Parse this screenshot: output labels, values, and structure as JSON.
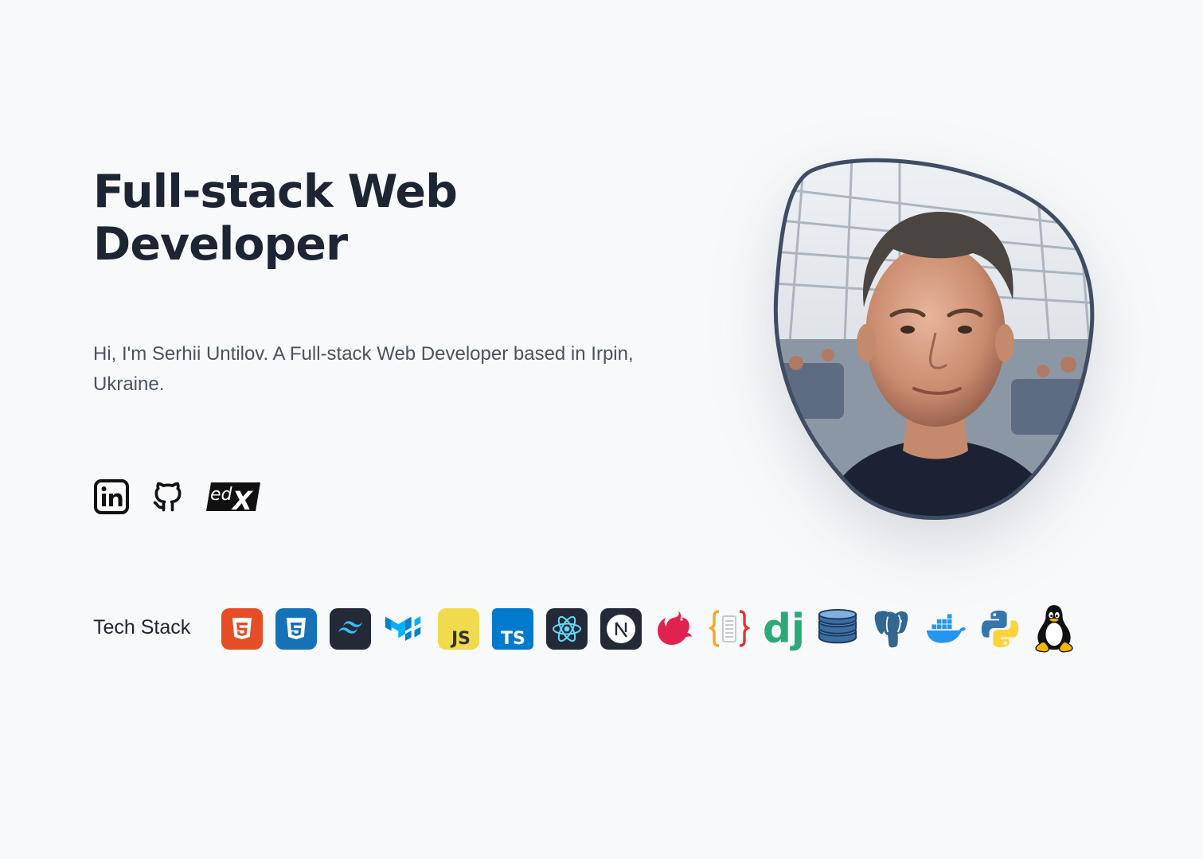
{
  "hero": {
    "title": "Full-stack Web Developer",
    "intro": "Hi, I'm Serhii Untilov. A Full-stack Web Developer based in Irpin, Ukraine."
  },
  "socials": [
    {
      "name": "LinkedIn",
      "icon": "linkedin-icon"
    },
    {
      "name": "GitHub",
      "icon": "github-icon"
    },
    {
      "name": "edX",
      "icon": "edx-icon"
    }
  ],
  "tech_stack": {
    "label": "Tech Stack",
    "items": [
      {
        "name": "HTML5",
        "icon": "html5-icon",
        "color": "#e44d26"
      },
      {
        "name": "CSS3",
        "icon": "css3-icon",
        "color": "#1572b6"
      },
      {
        "name": "Tailwind CSS",
        "icon": "tailwind-icon",
        "color": "#38bdf8"
      },
      {
        "name": "Material UI",
        "icon": "mui-icon",
        "color": "#0081cb"
      },
      {
        "name": "JavaScript",
        "icon": "javascript-icon",
        "color": "#f0db4f"
      },
      {
        "name": "TypeScript",
        "icon": "typescript-icon",
        "color": "#007acc"
      },
      {
        "name": "React",
        "icon": "react-icon",
        "color": "#61dafb"
      },
      {
        "name": "Next.js",
        "icon": "nextjs-icon",
        "color": "#1f2430"
      },
      {
        "name": "NestJS",
        "icon": "nestjs-icon",
        "color": "#e0234e"
      },
      {
        "name": "JSON",
        "icon": "json-icon",
        "color": "#f5a623"
      },
      {
        "name": "Django",
        "icon": "django-icon",
        "color": "#2ba977"
      },
      {
        "name": "Database",
        "icon": "database-icon",
        "color": "#2f5c8a"
      },
      {
        "name": "PostgreSQL",
        "icon": "postgresql-icon",
        "color": "#336791"
      },
      {
        "name": "Docker",
        "icon": "docker-icon",
        "color": "#2496ed"
      },
      {
        "name": "Python",
        "icon": "python-icon",
        "color": "#3776ab"
      },
      {
        "name": "Linux",
        "icon": "linux-icon",
        "color": "#000000"
      }
    ]
  },
  "profile_photo": {
    "subject": "Portrait of Serhii Untilov in an airport terminal",
    "border_color": "#3f4c63"
  }
}
